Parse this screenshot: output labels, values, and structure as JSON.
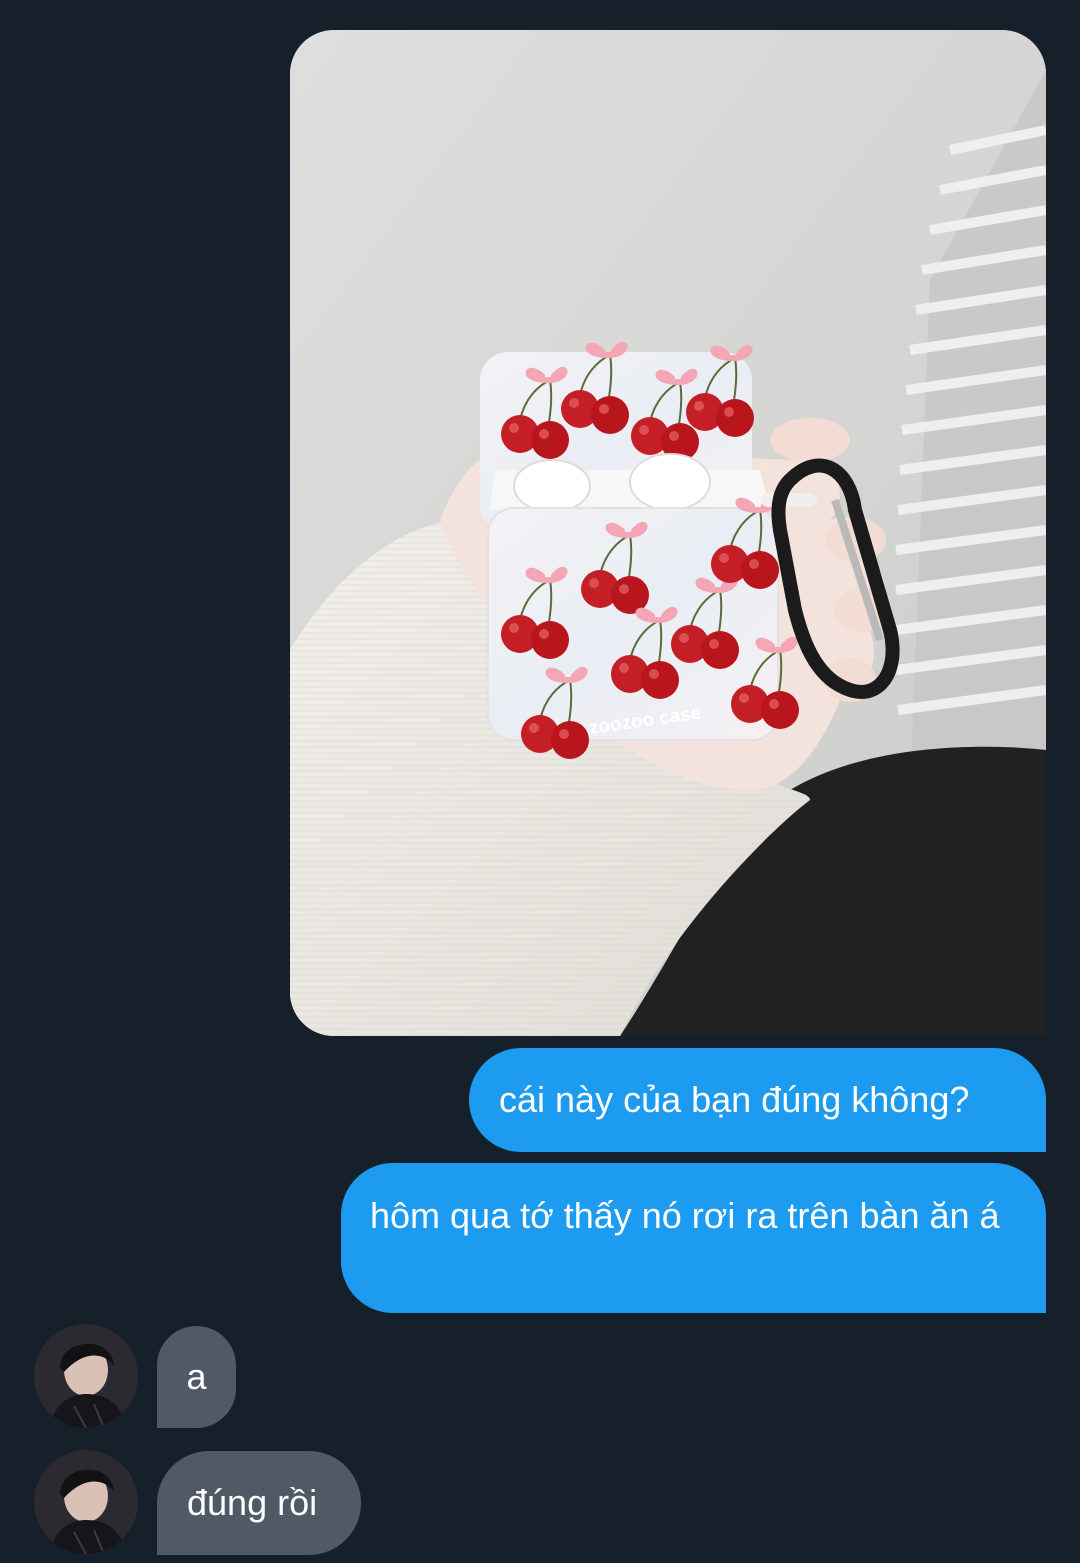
{
  "messages": [
    {
      "direction": "sent",
      "type": "image",
      "image_logo_text": "zoozoo case"
    },
    {
      "direction": "sent",
      "type": "text",
      "text": "cái này của bạn đúng không?"
    },
    {
      "direction": "sent",
      "type": "text",
      "text": "hôm qua tớ thấy nó rơi ra trên bàn ăn á"
    },
    {
      "direction": "received",
      "type": "text",
      "text": "a"
    },
    {
      "direction": "received",
      "type": "text",
      "text": "đúng rồi"
    }
  ],
  "colors": {
    "background": "#15202b",
    "sent_bubble": "#1d9bf0",
    "received_bubble": "#505a66",
    "text": "#ffffff"
  }
}
